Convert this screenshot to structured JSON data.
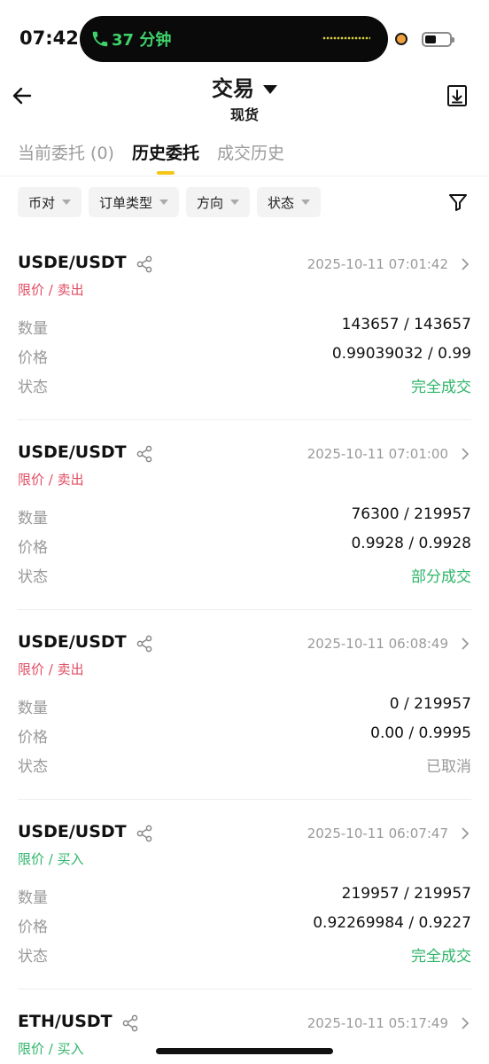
{
  "status_bar": {
    "time": "07:42",
    "call_label": "37 分钟",
    "battery_level": 0.45
  },
  "header": {
    "title": "交易",
    "subtitle": "现货",
    "back_icon": "arrow-left-icon",
    "export_icon": "download-export-icon"
  },
  "tabs": [
    {
      "label": "当前委托 (0)",
      "active": false
    },
    {
      "label": "历史委托",
      "active": true
    },
    {
      "label": "成交历史",
      "active": false
    }
  ],
  "filters": [
    {
      "label": "币对"
    },
    {
      "label": "订单类型"
    },
    {
      "label": "方向"
    },
    {
      "label": "状态"
    }
  ],
  "row_labels": {
    "quantity": "数量",
    "price": "价格",
    "status": "状态"
  },
  "orders": [
    {
      "pair": "USDE/USDT",
      "time": "2025-10-11 07:01:42",
      "type": "限价 / 卖出",
      "side": "sell",
      "quantity": "143657 / 143657",
      "price": "0.99039032 / 0.99",
      "status": "完全成交",
      "status_kind": "done"
    },
    {
      "pair": "USDE/USDT",
      "time": "2025-10-11 07:01:00",
      "type": "限价 / 卖出",
      "side": "sell",
      "quantity": "76300 / 219957",
      "price": "0.9928 / 0.9928",
      "status": "部分成交",
      "status_kind": "done"
    },
    {
      "pair": "USDE/USDT",
      "time": "2025-10-11 06:08:49",
      "type": "限价 / 卖出",
      "side": "sell",
      "quantity": "0 / 219957",
      "price": "0.00 / 0.9995",
      "status": "已取消",
      "status_kind": "cancel"
    },
    {
      "pair": "USDE/USDT",
      "time": "2025-10-11 06:07:47",
      "type": "限价 / 买入",
      "side": "buy",
      "quantity": "219957 / 219957",
      "price": "0.92269984 / 0.9227",
      "status": "完全成交",
      "status_kind": "done"
    },
    {
      "pair": "ETH/USDT",
      "time": "2025-10-11 05:17:49",
      "type": "限价 / 买入",
      "side": "buy"
    }
  ],
  "colors": {
    "accent": "#f5c518",
    "sell": "#e14c62",
    "buy": "#2fb56a",
    "muted": "#999999"
  }
}
